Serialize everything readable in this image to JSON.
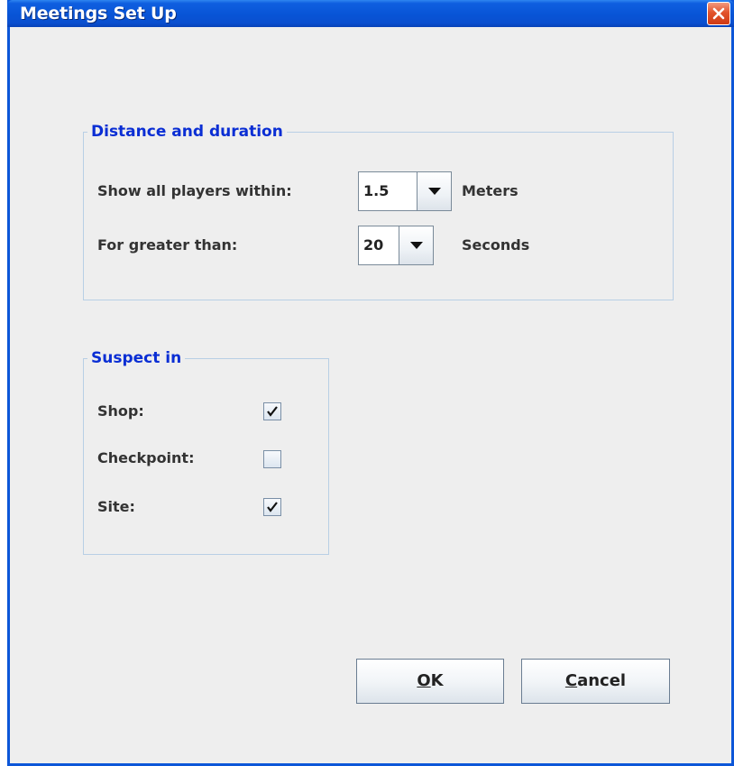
{
  "window": {
    "title": "Meetings Set Up"
  },
  "distance_group": {
    "legend": "Distance and duration",
    "distance_label": "Show all players within:",
    "distance_value": "1.5",
    "distance_unit": "Meters",
    "duration_label": "For greater than:",
    "duration_value": "20",
    "duration_unit": "Seconds"
  },
  "suspect_group": {
    "legend": "Suspect in",
    "items": [
      {
        "label": "Shop:",
        "checked": true
      },
      {
        "label": "Checkpoint:",
        "checked": false
      },
      {
        "label": "Site:",
        "checked": true
      }
    ]
  },
  "buttons": {
    "ok_mnemonic": "O",
    "ok_rest": "K",
    "cancel_mnemonic": "C",
    "cancel_rest": "ancel"
  },
  "icons": {
    "close": "close-icon",
    "dropdown": "triangle-down-icon",
    "check": "checkmark-icon"
  }
}
